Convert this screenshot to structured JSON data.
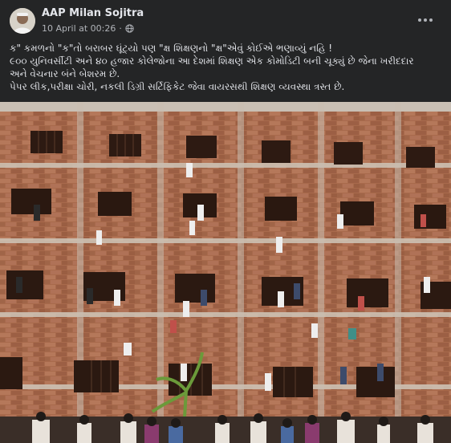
{
  "post": {
    "author": "AAP Milan Sojitra",
    "timestamp": "10 April at 00:26",
    "separator": "·",
    "privacy_icon": "globe-icon",
    "menu_icon": "more-options-icon",
    "text_lines": [
      "ક\" કમળનો \"ક\"તો બરાબર ઘૂંટ્યો પણ \"ક્ષ શિક્ષણનો \"ક્ષ\"એવું કોઈએ ભણાવ્યું નહિ !",
      "૯૦૦ યુનિવર્સીટી અને ૪૦ હજાર કોલેજોના આ દેશમાં શિક્ષણ એક કોમોડિટી બની ચૂક્યું છે જેના ખરીદદાર",
      "અને વેચનાર બંને બેશરમ છે.",
      "પેપર લીક,પરીક્ષા ચોરી, નકલી ડિગ્રી સર્ટિફિકેટ જેવા વાયરસથી શિક્ષણ વ્યવસ્થા ત્રસ્ત છે."
    ]
  },
  "colors": {
    "background": "#242526",
    "text": "#e4e6eb",
    "secondary_text": "#b0b3b8",
    "brick": "#a86a4c",
    "plaster": "#cfc5b8"
  }
}
